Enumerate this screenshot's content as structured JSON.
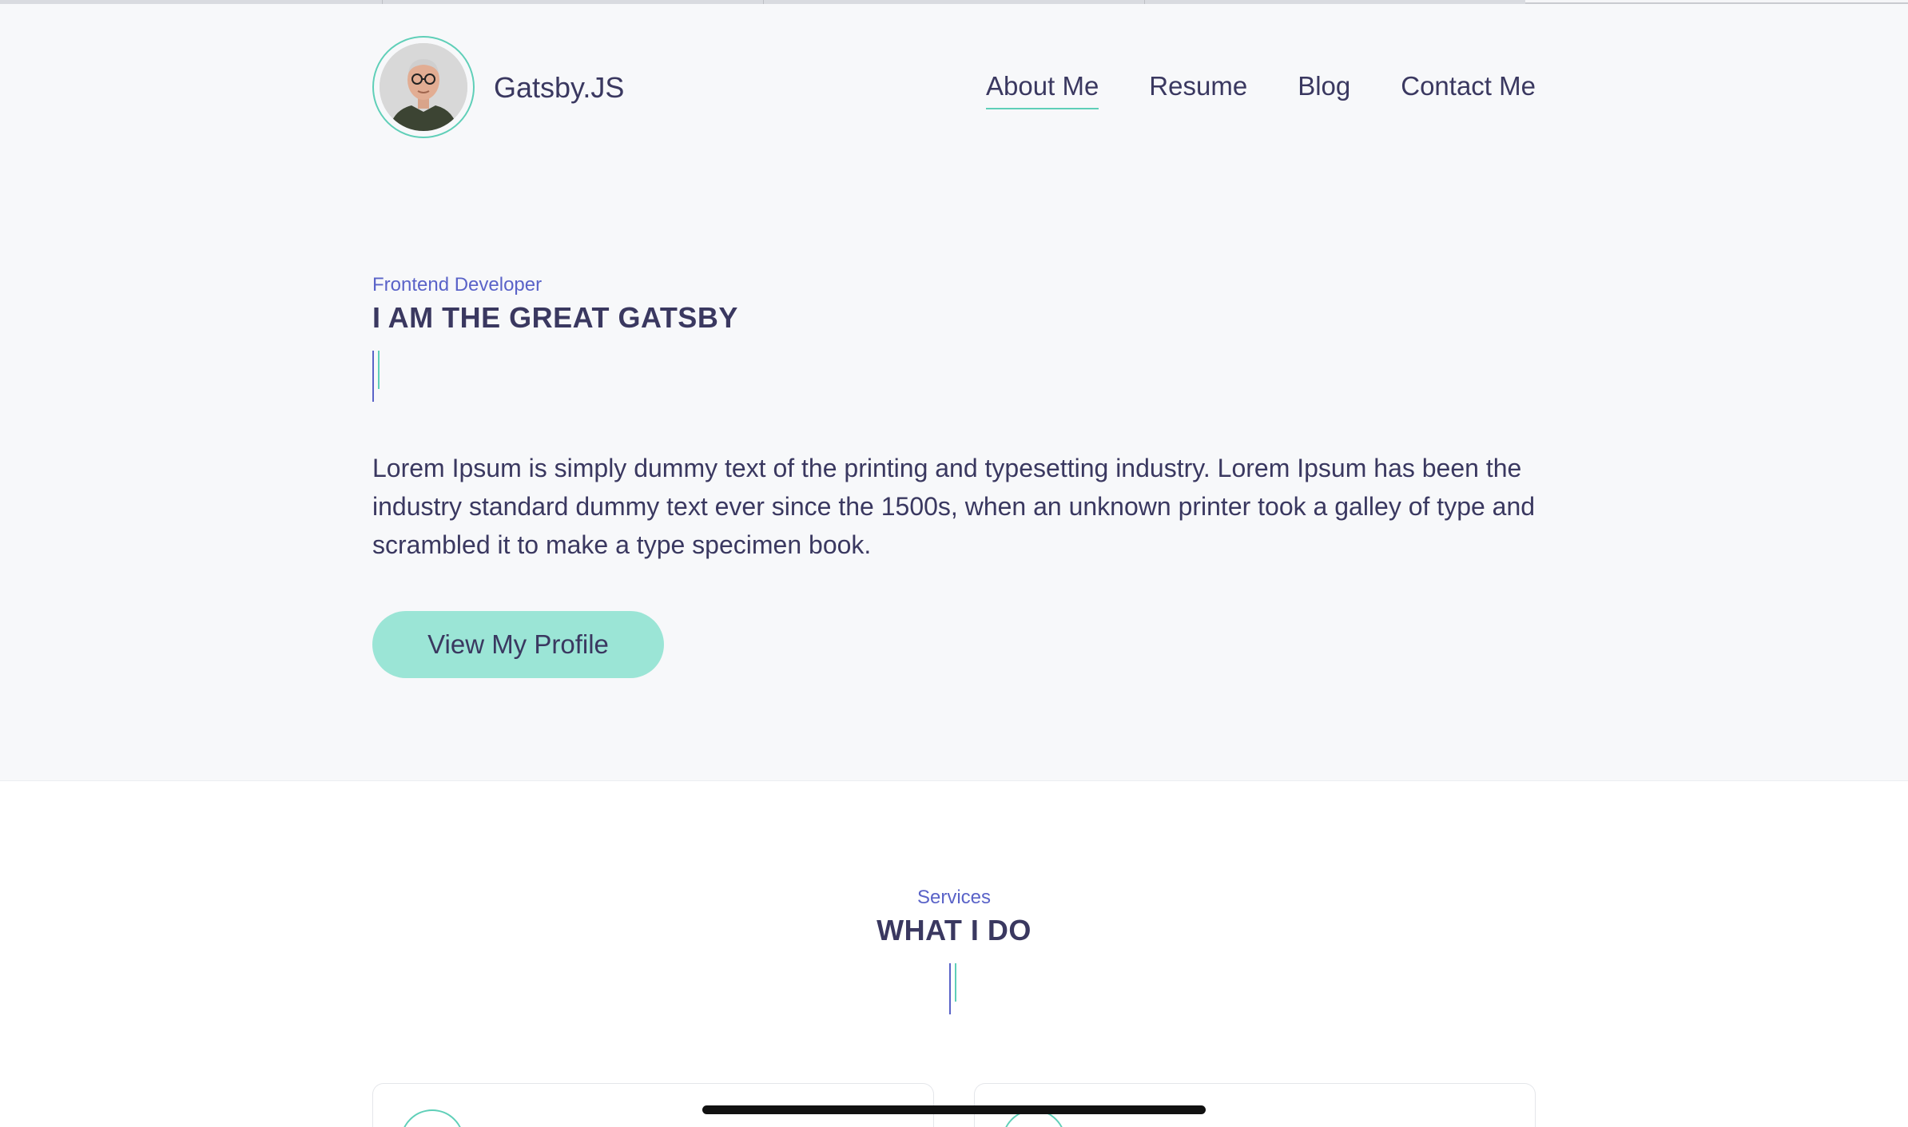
{
  "site": {
    "brand": "Gatsby.JS",
    "avatar_alt": "profile photo"
  },
  "nav": {
    "items": [
      {
        "label": "About Me",
        "active": true
      },
      {
        "label": "Resume",
        "active": false
      },
      {
        "label": "Blog",
        "active": false
      },
      {
        "label": "Contact Me",
        "active": false
      }
    ]
  },
  "hero": {
    "eyebrow": "Frontend Developer",
    "title": "I AM THE GREAT GATSBY",
    "bio": "Lorem Ipsum is simply dummy text of the printing and typesetting industry. Lorem Ipsum has been the industry standard dummy text ever since the 1500s, when an unknown printer took a galley of type and scrambled it to make a type specimen book.",
    "cta_label": "View My Profile"
  },
  "services": {
    "eyebrow": "Services",
    "title": "WHAT I DO"
  },
  "colors": {
    "accent_teal": "#5fcfb8",
    "accent_indigo": "#5a63c8",
    "text_dark": "#3a3860",
    "button_bg": "#9be5d6",
    "hero_bg": "#f7f8fa"
  }
}
